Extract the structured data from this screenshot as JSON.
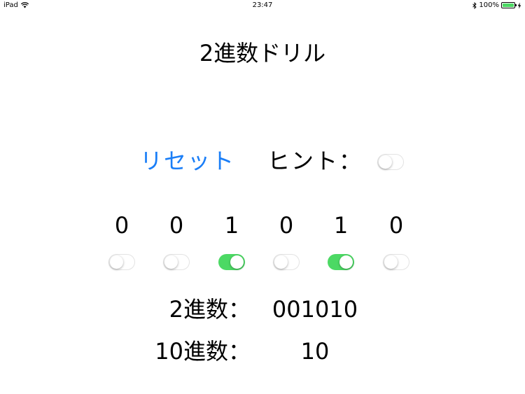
{
  "status_bar": {
    "device": "iPad",
    "time": "23:47",
    "battery_percent": "100%",
    "battery_level": 1.0
  },
  "title": "2進数ドリル",
  "controls": {
    "reset_label": "リセット",
    "hint_label": "ヒント：",
    "hint_on": false
  },
  "bits": [
    {
      "digit": "0",
      "on": false
    },
    {
      "digit": "0",
      "on": false
    },
    {
      "digit": "1",
      "on": true
    },
    {
      "digit": "0",
      "on": false
    },
    {
      "digit": "1",
      "on": true
    },
    {
      "digit": "0",
      "on": false
    }
  ],
  "results": {
    "binary_label": "2進数：",
    "binary_value": "001010",
    "decimal_label": "10進数：",
    "decimal_value": "10"
  },
  "colors": {
    "accent": "#1a7ef7",
    "switch_on": "#4cd964"
  },
  "icons": [
    "wifi-icon",
    "bluetooth-icon",
    "battery-icon",
    "charging-icon"
  ]
}
